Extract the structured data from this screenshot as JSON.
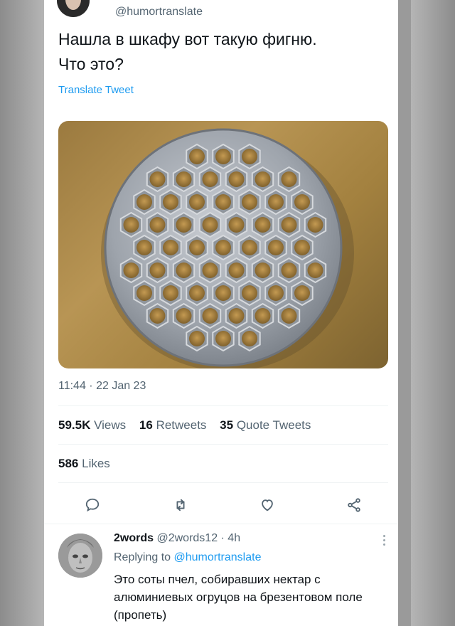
{
  "tweet": {
    "handle": "@humortranslate",
    "text_line1": "Нашла в шкафу вот такую фигню.",
    "text_line2": "Что это?",
    "translate_label": "Translate Tweet",
    "timestamp": "11:44 · 22 Jan 23"
  },
  "stats": {
    "views_count": "59.5K",
    "views_label": "Views",
    "retweets_count": "16",
    "retweets_label": "Retweets",
    "quotes_count": "35",
    "quotes_label": "Quote Tweets",
    "likes_count": "586",
    "likes_label": "Likes"
  },
  "actions": {
    "icons": [
      "reply-icon",
      "retweet-icon",
      "like-icon",
      "share-icon"
    ]
  },
  "reply": {
    "name": "2words",
    "handle_time": "@2words12 · 4h",
    "replying_prefix": "Replying to",
    "replying_mention": "@humortranslate",
    "text": "Это соты пчел, собиравших нектар с алюминиевых огруцов на брезентовом поле (пропеть)"
  },
  "colors": {
    "accent": "#1d9bf0",
    "text": "#0f1419",
    "muted": "#536471"
  }
}
